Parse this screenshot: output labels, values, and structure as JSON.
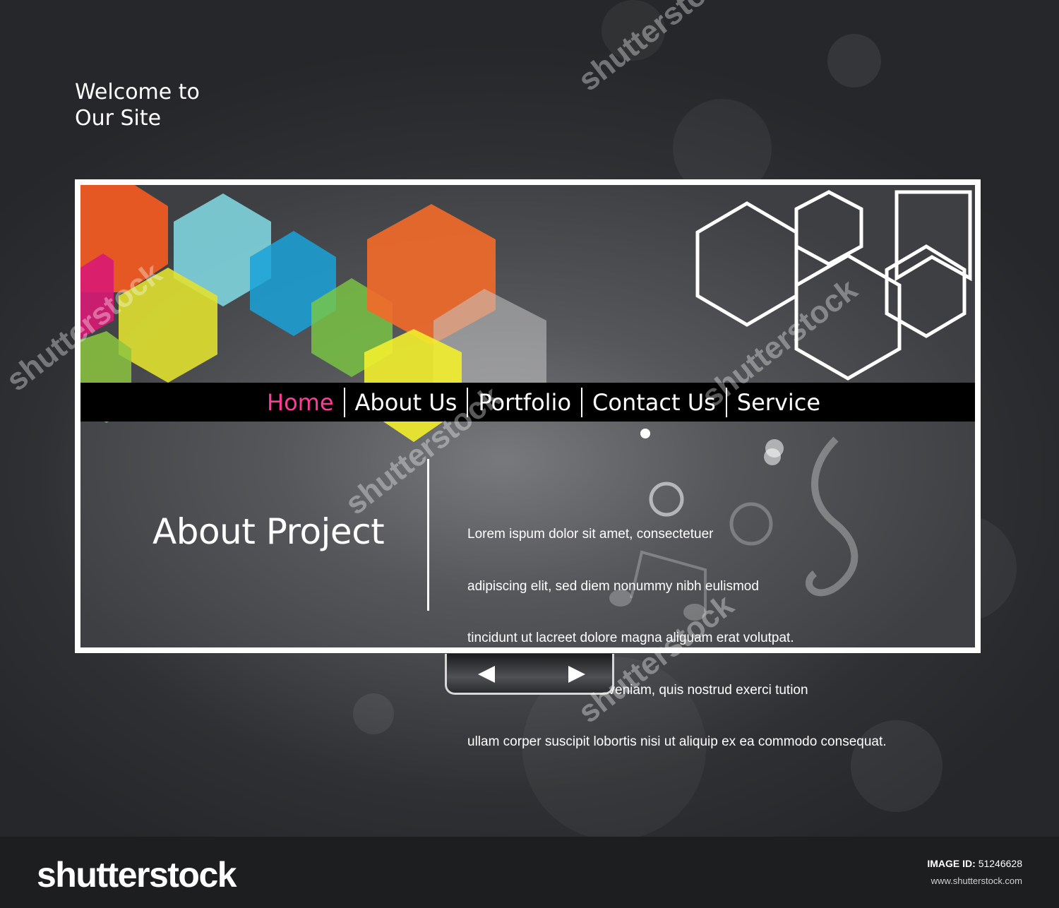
{
  "header": {
    "welcome_line1": "Welcome to",
    "welcome_line2": "Our Site"
  },
  "nav": {
    "items": [
      {
        "label": "Home",
        "active": true
      },
      {
        "label": "About Us",
        "active": false
      },
      {
        "label": "Portfolio",
        "active": false
      },
      {
        "label": "Contact Us",
        "active": false
      },
      {
        "label": "Service",
        "active": false
      }
    ]
  },
  "content": {
    "title": "About Project",
    "body_lines": [
      "Lorem ispum dolor sit amet, consectetuer",
      "adipiscing elit, sed diem nonummy nibh eulismod",
      "tincidunt ut lacreet dolore magna aliguam erat volutpat.",
      "Ut wisis enim ad minim veniam, quis nostrud exerci tution",
      "ullam corper suscipit lobortis nisi ut aliquip ex ea commodo consequat."
    ]
  },
  "slider": {
    "prev_icon": "triangle-left-icon",
    "next_icon": "triangle-right-icon"
  },
  "footer": {
    "logo": "shutterstock",
    "image_id_label": "IMAGE ID:",
    "image_id_value": "51246628",
    "site_url": "www.shutterstock.com"
  },
  "watermark": {
    "text": "shutterstock"
  },
  "colors": {
    "active_nav": "#ff3b9a",
    "navbar_bg": "#000000",
    "frame_border": "#ffffff",
    "background": "#2e3033"
  }
}
